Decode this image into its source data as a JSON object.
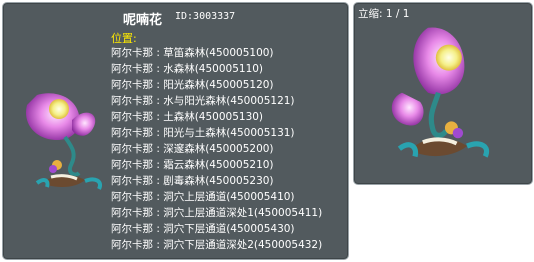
{
  "monster": {
    "name": "呢喃花",
    "id": "ID:3003337"
  },
  "location_label": "位置:",
  "locations": [
    "阿尔卡那 : 草笛森林(450005100)",
    "阿尔卡那 : 水森林(450005110)",
    "阿尔卡那 : 阳光森林(450005120)",
    "阿尔卡那 : 水与阳光森林(450005121)",
    "阿尔卡那 : 土森林(450005130)",
    "阿尔卡那 : 阳光与土森林(450005131)",
    "阿尔卡那 : 深邃森林(450005200)",
    "阿尔卡那 : 霜云森林(450005210)",
    "阿尔卡那 : 剧毒森林(450005230)",
    "阿尔卡那 : 洞穴上层通道(450005410)",
    "阿尔卡那 : 洞穴上层通道深处1(450005411)",
    "阿尔卡那 : 洞穴下层通道(450005430)",
    "阿尔卡那 : 洞穴下层通道深处2(450005432)"
  ],
  "stand": {
    "label": "立缩: 1 / 1"
  },
  "colors": {
    "panel_bg": "#525a5e",
    "label_yellow": "#ffea00",
    "text": "#ffffff"
  }
}
